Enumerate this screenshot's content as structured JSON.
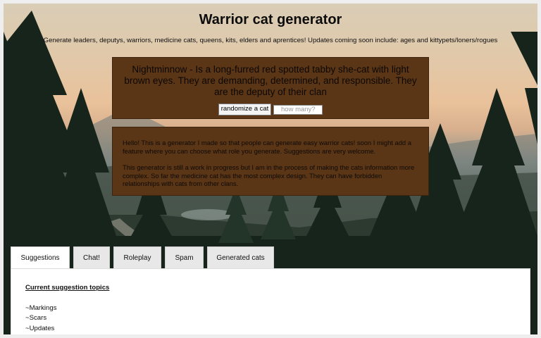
{
  "page": {
    "title": "Warrior cat generator",
    "subtitle": "Generate leaders, deputys, warriors, medicine cats, queens, kits, elders and aprentices! Updates coming soon include: ages and kittypets/loners/rogues"
  },
  "generator": {
    "output": "Nightminnow - Is a long-furred red spotted tabby she-cat with light brown eyes. They are demanding, determined, and responsible. They are the deputy of their clan",
    "randomize_label": "randomize a cat",
    "count_placeholder": "how many?"
  },
  "info": {
    "paragraph1": "Hello! This is a generator I made so that people can generate easy warrior cats! soon I might add a feature where you can choose what role you generate. Suggestions are very welcome.",
    "paragraph2": "This generator is still a work in progress but I am in the process of making the cats information more complex. So far the medicine cat has the most complex design. They can have forbidden relationships with cats from other clans."
  },
  "tabs": [
    {
      "label": "Suggestions"
    },
    {
      "label": "Chat!"
    },
    {
      "label": "Roleplay"
    },
    {
      "label": "Spam"
    },
    {
      "label": "Generated cats"
    }
  ],
  "panel": {
    "heading": "Current suggestion topics",
    "items": [
      "~Markings",
      "~Scars",
      "~Updates"
    ]
  },
  "colors": {
    "box": "#5a3516",
    "tab_active": "#ffffff",
    "tab_inactive": "#e8e8e8"
  }
}
